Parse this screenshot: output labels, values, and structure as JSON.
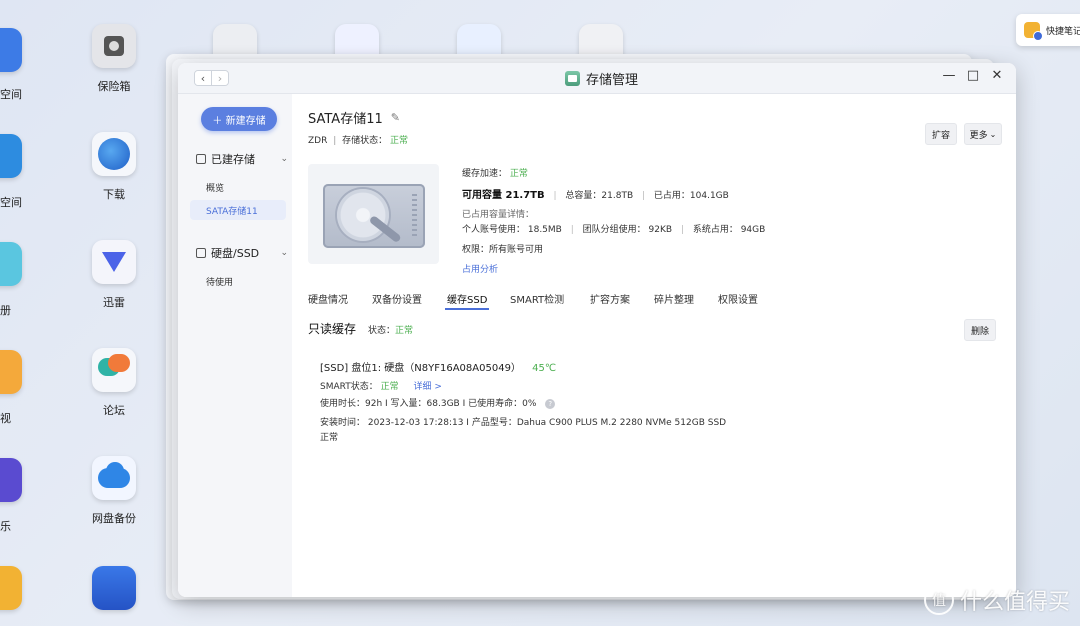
{
  "desktop": {
    "left_labels": [
      "空间",
      "空间",
      "册",
      "视",
      "乐"
    ],
    "icons": [
      {
        "label": "保险箱",
        "icon": "safe-icon",
        "color": "#e9eaee"
      },
      {
        "label": "下载",
        "icon": "download-globe-icon",
        "color": "#2e6fd8"
      },
      {
        "label": "迅雷",
        "icon": "thunder-bird-icon",
        "color": "#f1f3ff"
      },
      {
        "label": "论坛",
        "icon": "forum-chat-icon",
        "color": "#2aa8a0"
      },
      {
        "label": "网盘备份",
        "icon": "cloud-backup-icon",
        "color": "#eef4ff"
      }
    ],
    "note_widget": {
      "label": "快捷笔记"
    }
  },
  "window": {
    "title": "存储管理",
    "nav_back": "‹",
    "nav_forward": "›",
    "controls": {
      "minimize": "—",
      "maximize": "□",
      "close": "✕"
    }
  },
  "sidebar": {
    "new_button": "＋ 新建存储",
    "group1": {
      "label": "已建存储",
      "items": [
        "概览",
        "SATA存储11"
      ]
    },
    "group2": {
      "label": "硬盘/SSD",
      "items": [
        "待使用"
      ]
    }
  },
  "volume": {
    "name": "SATA存储11",
    "type": "ZDR",
    "status_label": "存储状态：",
    "status_value": "正常",
    "expand_button": "扩容",
    "more_button": "更多",
    "cache_accel_label": "缓存加速：",
    "cache_accel_value": "正常",
    "available": "可用容量 21.7TB",
    "total": "总容量：21.8TB",
    "used": "已占用：104.1GB",
    "detail_label": "已占用容量详情：",
    "personal": "个人账号使用：  18.5MB",
    "team": "团队分组使用：  92KB",
    "system": "系统占用：  94GB",
    "permission": "权限：所有账号可用",
    "analysis_link": "占用分析"
  },
  "tabs": [
    "硬盘情况",
    "双备份设置",
    "缓存SSD",
    "SMART检测",
    "扩容方案",
    "碎片整理",
    "权限设置"
  ],
  "active_tab": "缓存SSD",
  "cache": {
    "title": "只读缓存",
    "status_label": "状态：",
    "status_value": "正常",
    "delete_button": "删除",
    "ssd": {
      "title": "[SSD] 盘位1:   硬盘（N8YF16A08A05049）",
      "temp": "45℃",
      "smart_label": "SMART状态：",
      "smart_value": "正常",
      "detail_link": "详细 >",
      "usage": "使用时长：92h  I  写入量：68.3GB  I  已使用寿命：0%",
      "install": "安装时间：  2023-12-03 17:28:13  I  产品型号：Dahua C900 PLUS M.2 2280 NVMe 512GB SSD",
      "status": "正常"
    }
  },
  "watermark": {
    "symbol": "值",
    "text": "什么值得买"
  }
}
